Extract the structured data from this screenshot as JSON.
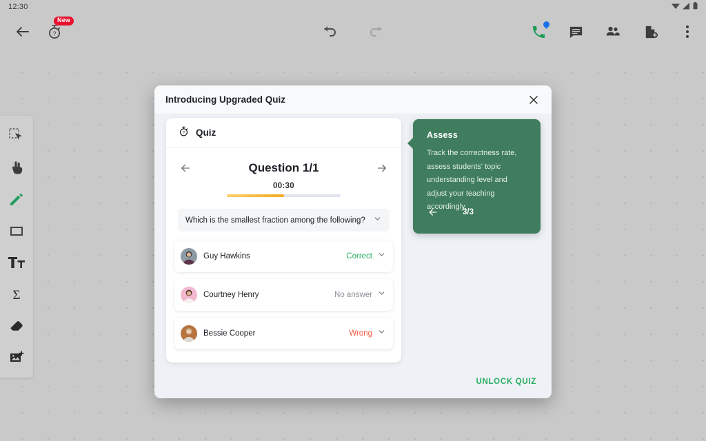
{
  "statusbar": {
    "clock": "12:30",
    "wifi_icon": "wifi-icon",
    "signal_icon": "signal-icon",
    "battery_icon": "battery-icon"
  },
  "toolbar": {
    "back_icon": "back-arrow-icon",
    "quiz_icon": "quiz-stopwatch-icon",
    "quiz_badge": "New",
    "undo_icon": "undo-icon",
    "redo_icon": "redo-icon",
    "call_icon": "phone-call-icon",
    "chat_icon": "chat-icon",
    "people_icon": "people-icon",
    "add_doc_icon": "add-document-icon",
    "more_icon": "more-vertical-icon"
  },
  "rail": {
    "items": [
      {
        "name": "select-tool",
        "icon": "select-cursor-icon"
      },
      {
        "name": "hand-tool",
        "icon": "hand-pointer-icon"
      },
      {
        "name": "pen-tool",
        "icon": "pencil-icon"
      },
      {
        "name": "shape-tool",
        "icon": "square-icon"
      },
      {
        "name": "text-tool",
        "icon": "text-icon"
      },
      {
        "name": "formula-tool",
        "icon": "sigma-icon"
      },
      {
        "name": "eraser-tool",
        "icon": "eraser-icon"
      },
      {
        "name": "image-tool",
        "icon": "add-image-icon"
      }
    ]
  },
  "modal": {
    "title": "Introducing Upgraded Quiz",
    "close_icon": "close-icon",
    "footer_button": "UNLOCK QUIZ"
  },
  "quiz": {
    "header_label": "Quiz",
    "header_icon": "stopwatch-question-icon",
    "prev_icon": "arrow-left-icon",
    "next_icon": "arrow-right-icon",
    "question_counter": "Question 1/1",
    "timer": "00:30",
    "timer_progress_percent": 50,
    "question_text": "Which is the smallest fraction among the following?",
    "question_chevron_icon": "chevron-down-icon",
    "students": [
      {
        "name": "Guy Hawkins",
        "status": "Correct",
        "status_kind": "correct",
        "avatar": "avatar-photo",
        "chevron_icon": "chevron-down-icon"
      },
      {
        "name": "Courtney Henry",
        "status": "No answer",
        "status_kind": "noanswer",
        "avatar": "avatar-photo",
        "chevron_icon": "chevron-down-icon"
      },
      {
        "name": "Bessie Cooper",
        "status": "Wrong",
        "status_kind": "wrong",
        "avatar": "avatar-photo",
        "chevron_icon": "chevron-down-icon"
      }
    ]
  },
  "tooltip": {
    "title": "Assess",
    "body": "Track the correctness rate, assess students' topic understanding level and adjust your teaching accordingly.",
    "back_icon": "arrow-left-icon",
    "step": "3/3"
  },
  "colors": {
    "accent_green": "#27ae60",
    "tooltip_green": "#3f7d5e",
    "wrong_red": "#f4543c",
    "badge_red": "#e8112d",
    "timer_amber": "#f5ab23",
    "canvas": "#c9c9c9"
  }
}
